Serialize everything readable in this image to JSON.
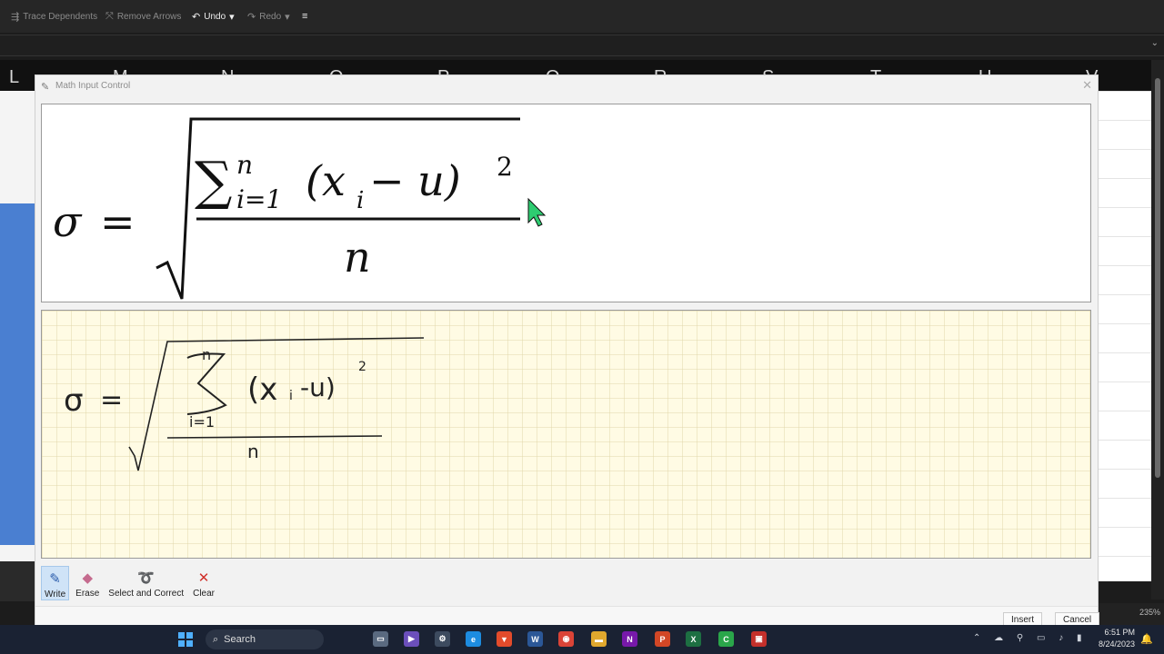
{
  "ribbon": {
    "trace_dependents": "Trace Dependents",
    "remove_arrows": "Remove Arrows",
    "undo": "Undo",
    "redo": "Redo"
  },
  "columns": [
    "L",
    "M",
    "N",
    "O",
    "P",
    "Q",
    "R",
    "S",
    "T",
    "U",
    "V"
  ],
  "dialog": {
    "title": "Math Input Control",
    "tools": [
      "Write",
      "Erase",
      "Select and Correct",
      "Clear"
    ],
    "active_tool": "Write",
    "insert": "Insert",
    "cancel": "Cancel"
  },
  "preview_formula": {
    "lhs": "σ",
    "equals": "=",
    "sum_upper": "n",
    "sum_lower": "i=1",
    "numerator_body": "(x",
    "subscript": "i",
    "minus_u": " − u)",
    "exponent": "2",
    "denominator": "n"
  },
  "handwritten": {
    "lhs": "σ",
    "equals": "=",
    "upper": "n",
    "lower": "i=1",
    "body": "(x",
    "subscript": "i",
    "minus_u": "-u)",
    "exponent": "2",
    "denominator": "n"
  },
  "statusbar": {
    "zoom": "235%"
  },
  "taskbar": {
    "search": "Search",
    "time": "6:51 PM",
    "date": "8/24/2023"
  },
  "colors": {
    "writepad_bg": "#fffbe4",
    "selection_blue": "#4a7fd1",
    "cursor_green": "#2ecc71"
  }
}
